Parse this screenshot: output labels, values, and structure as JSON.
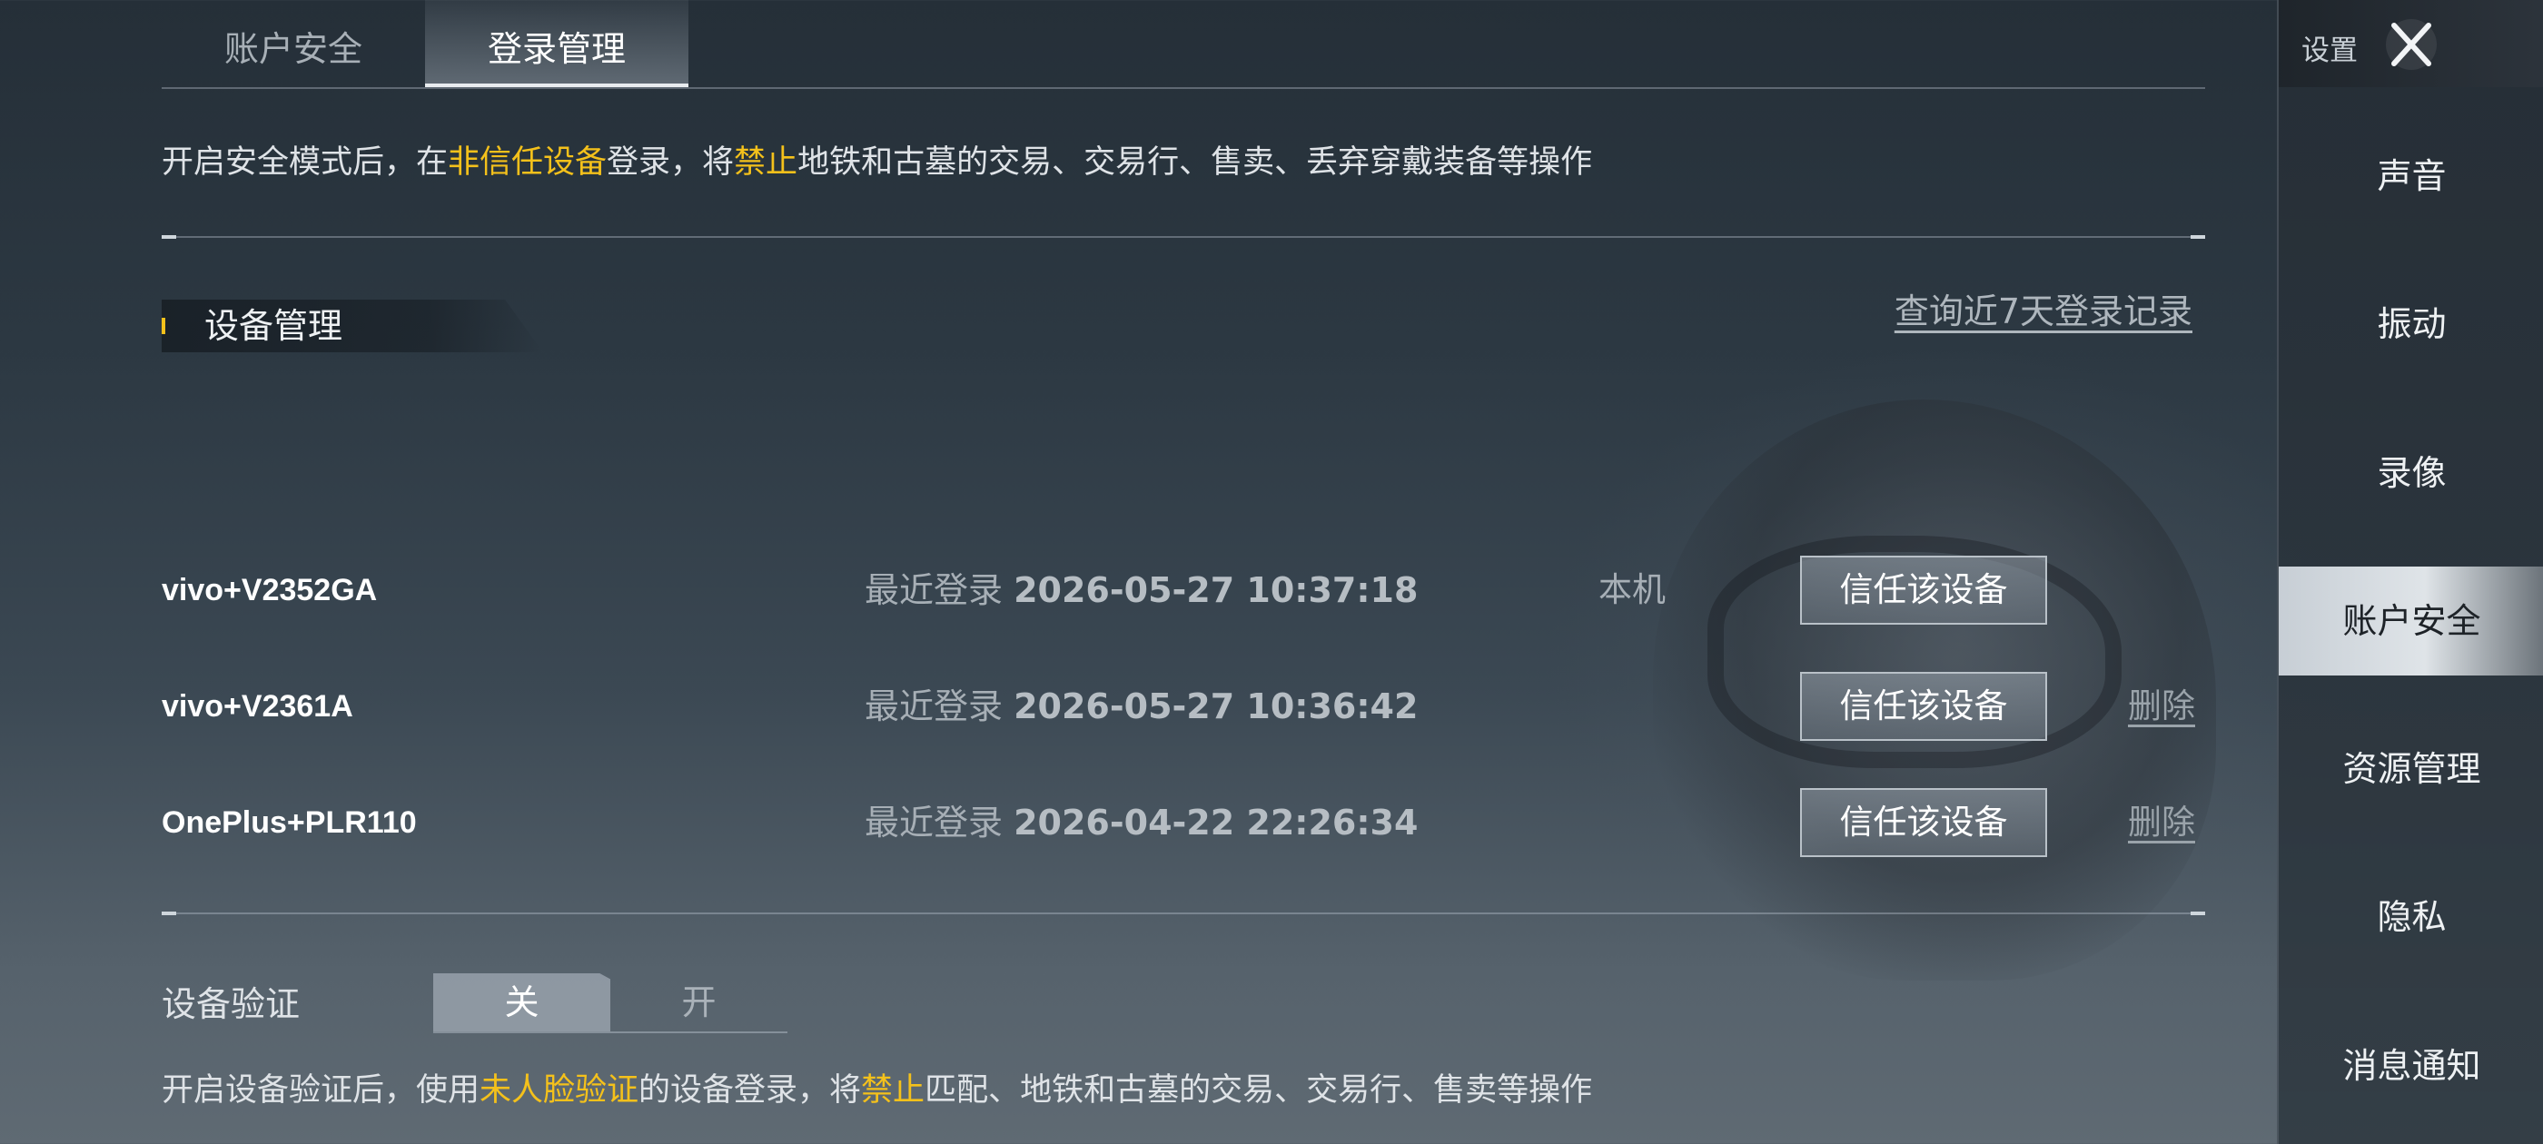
{
  "tabs": [
    {
      "label": "账户安全",
      "active": false
    },
    {
      "label": "登录管理",
      "active": true
    }
  ],
  "security_notice": {
    "part1": "开启安全模式后，在",
    "highlight1": "非信任设备",
    "part2": "登录，将",
    "highlight2": "禁止",
    "part3": "地铁和古墓的交易、交易行、售卖、丢弃穿戴装备等操作"
  },
  "device_section": {
    "title": "设备管理",
    "query_link": "查询近7天登录记录"
  },
  "devices": [
    {
      "name": "vivo+V2352GA",
      "time_label": "最近登录",
      "timestamp": "2026-05-27 10:37:18",
      "local_label": "本机",
      "trust_label": "信任该设备",
      "delete_label": ""
    },
    {
      "name": "vivo+V2361A",
      "time_label": "最近登录",
      "timestamp": "2026-05-27 10:36:42",
      "local_label": "",
      "trust_label": "信任该设备",
      "delete_label": "删除"
    },
    {
      "name": "OnePlus+PLR110",
      "time_label": "最近登录",
      "timestamp": "2026-04-22 22:26:34",
      "local_label": "",
      "trust_label": "信任该设备",
      "delete_label": "删除"
    }
  ],
  "device_verify": {
    "label": "设备验证",
    "off_label": "关",
    "on_label": "开",
    "state": "off"
  },
  "verify_notice": {
    "part1": "开启设备验证后，使用",
    "highlight1": "未人脸验证",
    "part2": "的设备登录，将",
    "highlight2": "禁止",
    "part3": "匹配、地铁和古墓的交易、交易行、售卖等操作"
  },
  "sidebar": {
    "title": "设置",
    "items": [
      {
        "label": "声音"
      },
      {
        "label": "振动"
      },
      {
        "label": "录像"
      },
      {
        "label": "账户安全",
        "active": true
      },
      {
        "label": "资源管理"
      },
      {
        "label": "隐私"
      },
      {
        "label": "消息通知"
      }
    ]
  },
  "colors": {
    "highlight": "#f4c11b",
    "background_top": "#252f38",
    "background_bottom": "#5f6a73"
  }
}
